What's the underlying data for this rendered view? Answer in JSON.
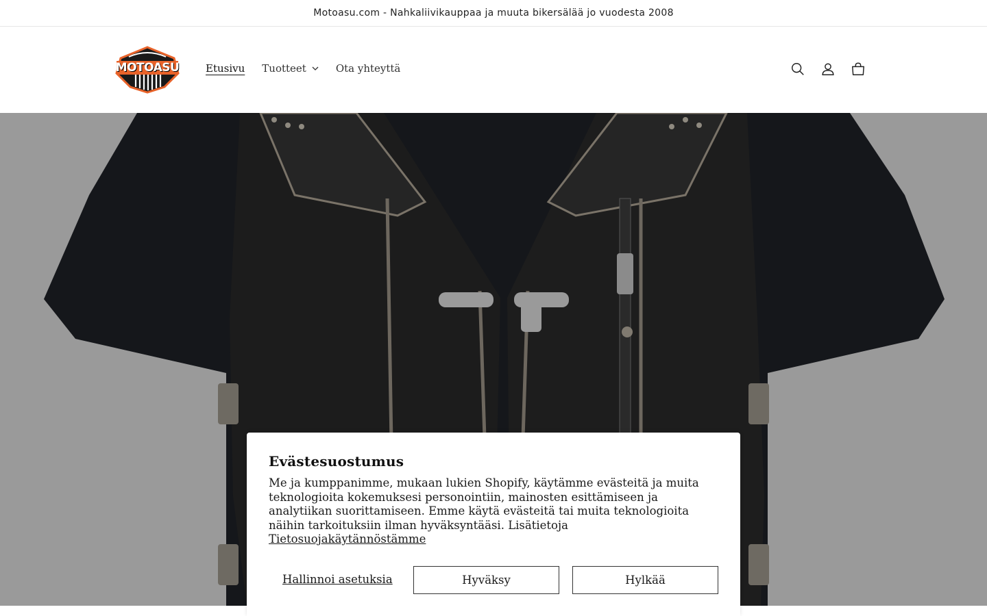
{
  "announcement": {
    "text": "Motoasu.com - Nahkaliivikauppaa ja muuta bikersälää jo vuodesta 2008"
  },
  "header": {
    "logo_text": "MOTOASU",
    "nav": [
      {
        "label": "Etusivu",
        "active": true
      },
      {
        "label": "Tuotteet",
        "has_dropdown": true
      },
      {
        "label": "Ota yhteyttä"
      }
    ],
    "icons": [
      "search-icon",
      "account-icon",
      "cart-icon"
    ]
  },
  "hero": {
    "image": "black leather biker vest over black t-shirt on grey background"
  },
  "cookie_banner": {
    "title": "Evästesuostumus",
    "body": "Me ja kumppanimme, mukaan lukien Shopify, käytämme evästeitä ja muita teknologioita kokemuksesi personointiin, mainosten esittämiseen ja analytiikan suorittamiseen. Emme käytä evästeitä tai muita teknologioita näihin tarkoituksiin ilman hyväksyntääsi. Lisätietoja",
    "policy_link": "Tietosuojakäytännöstämme",
    "manage_label": "Hallinnoi asetuksia",
    "accept_label": "Hyväksy",
    "decline_label": "Hylkää"
  },
  "colors": {
    "hero_bg": "#9a9a9a",
    "logo_orange": "#e8632a",
    "text": "#121212"
  }
}
